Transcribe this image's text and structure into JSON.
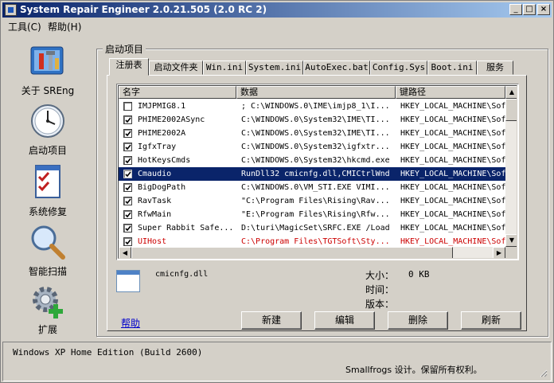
{
  "window": {
    "title": "System Repair Engineer 2.0.21.505 (2.0 RC 2)",
    "min": "_",
    "max": "□",
    "close": "×"
  },
  "menu": [
    {
      "label": "工具(C)"
    },
    {
      "label": "帮助(H)"
    }
  ],
  "sidebar": [
    {
      "label": "关于 SREng",
      "icon": "toolbox-icon"
    },
    {
      "label": "启动项目",
      "icon": "clock-icon"
    },
    {
      "label": "系统修复",
      "icon": "checklist-icon"
    },
    {
      "label": "智能扫描",
      "icon": "magnifier-icon"
    },
    {
      "label": "扩展",
      "icon": "gear-plus-icon"
    }
  ],
  "group_title": "启动项目",
  "tabs": [
    {
      "label": "注册表",
      "active": true
    },
    {
      "label": "启动文件夹"
    },
    {
      "label": "Win.ini"
    },
    {
      "label": "System.ini"
    },
    {
      "label": "AutoExec.bat"
    },
    {
      "label": "Config.Sys"
    },
    {
      "label": "Boot.ini"
    },
    {
      "label": "服务"
    }
  ],
  "table": {
    "columns": [
      "名字",
      "数据",
      "键路径"
    ],
    "rows": [
      {
        "checked": false,
        "name": "IMJPMIG8.1",
        "data": "; C:\\WINDOWS.0\\IME\\imjp8_1\\I...",
        "path": "HKEY_LOCAL_MACHINE\\Sof"
      },
      {
        "checked": true,
        "name": "PHIME2002ASync",
        "data": "C:\\WINDOWS.0\\System32\\IME\\TI...",
        "path": "HKEY_LOCAL_MACHINE\\Sof"
      },
      {
        "checked": true,
        "name": "PHIME2002A",
        "data": "C:\\WINDOWS.0\\System32\\IME\\TI...",
        "path": "HKEY_LOCAL_MACHINE\\Sof"
      },
      {
        "checked": true,
        "name": "IgfxTray",
        "data": "C:\\WINDOWS.0\\System32\\igfxtr...",
        "path": "HKEY_LOCAL_MACHINE\\Sof"
      },
      {
        "checked": true,
        "name": "HotKeysCmds",
        "data": "C:\\WINDOWS.0\\System32\\hkcmd.exe",
        "path": "HKEY_LOCAL_MACHINE\\Sof"
      },
      {
        "checked": true,
        "name": "Cmaudio",
        "data": "RunDll32 cmicnfg.dll,CMICtrlWnd",
        "path": "HKEY_LOCAL_MACHINE\\Sof",
        "selected": true
      },
      {
        "checked": true,
        "name": "BigDogPath",
        "data": "C:\\WINDOWS.0\\VM_STI.EXE VIMI...",
        "path": "HKEY_LOCAL_MACHINE\\Sof"
      },
      {
        "checked": true,
        "name": "RavTask",
        "data": "\"C:\\Program Files\\Rising\\Rav...",
        "path": "HKEY_LOCAL_MACHINE\\Sof"
      },
      {
        "checked": true,
        "name": "RfwMain",
        "data": "\"E:\\Program Files\\Rising\\Rfw...",
        "path": "HKEY_LOCAL_MACHINE\\Sof"
      },
      {
        "checked": true,
        "name": "Super Rabbit Safe...",
        "data": "D:\\turi\\MagicSet\\SRFC.EXE /Load",
        "path": "HKEY_LOCAL_MACHINE\\Sof"
      },
      {
        "checked": true,
        "name": "UIHost",
        "data": "C:\\Program Files\\TGTSoft\\Sty...",
        "path": "HKEY_LOCAL_MACHINE\\Sof",
        "red": true
      }
    ]
  },
  "detail": {
    "filename": "cmicnfg.dll",
    "size_label": "大小：",
    "size_value": "0 KB",
    "time_label": "时间：",
    "version_label": "版本："
  },
  "help_link": "帮助",
  "buttons": [
    {
      "label": "新建"
    },
    {
      "label": "编辑"
    },
    {
      "label": "删除"
    },
    {
      "label": "刷新"
    }
  ],
  "status": {
    "os": "Windows XP Home Edition  (Build 2600)",
    "copyright": "Smallfrogs 设计。保留所有权利。"
  }
}
